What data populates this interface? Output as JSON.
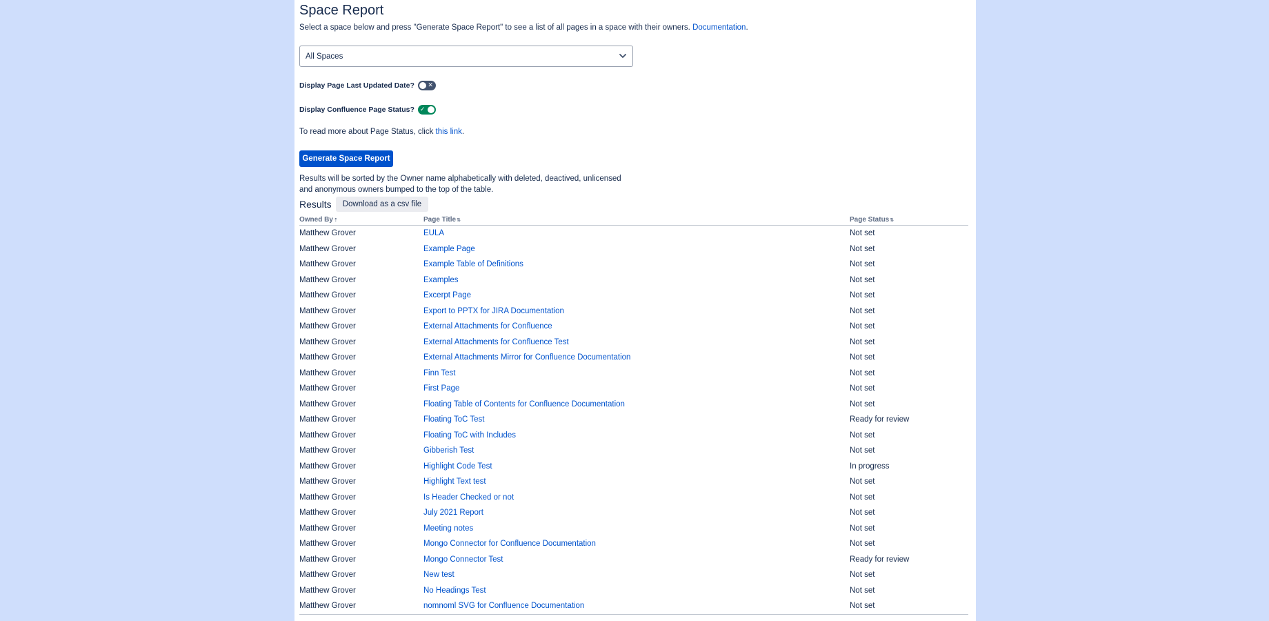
{
  "header": {
    "title": "Space Report",
    "intro_text": "Select a space below and press \"Generate Space Report\" to see a list of all pages in a space with their owners.",
    "intro_link": "Documentation",
    "intro_end": "."
  },
  "space_select": {
    "value": "All Spaces",
    "icon": "chevron-down-icon"
  },
  "options": {
    "last_updated_label": "Display Page Last Updated Date?",
    "last_updated_on": false,
    "page_status_label": "Display Confluence Page Status?",
    "page_status_on": true
  },
  "more_info": {
    "text": "To read more about Page Status, click",
    "link": "this link",
    "end": "."
  },
  "generate_button": "Generate Space Report",
  "sort_note": "Results will be sorted by the Owner name alphabetically with deleted, deactived, unlicensed and anonymous owners bumped to the top of the table.",
  "results": {
    "label": "Results",
    "download_button": "Download as a csv file",
    "columns": [
      "Owned By",
      "Page Title",
      "Page Status"
    ],
    "rows": [
      {
        "owner": "Matthew Grover",
        "title": "EULA",
        "status": "Not set"
      },
      {
        "owner": "Matthew Grover",
        "title": "Example Page",
        "status": "Not set"
      },
      {
        "owner": "Matthew Grover",
        "title": "Example Table of Definitions",
        "status": "Not set"
      },
      {
        "owner": "Matthew Grover",
        "title": "Examples",
        "status": "Not set"
      },
      {
        "owner": "Matthew Grover",
        "title": "Excerpt Page",
        "status": "Not set"
      },
      {
        "owner": "Matthew Grover",
        "title": "Export to PPTX for JIRA Documentation",
        "status": "Not set"
      },
      {
        "owner": "Matthew Grover",
        "title": "External Attachments for Confluence",
        "status": "Not set"
      },
      {
        "owner": "Matthew Grover",
        "title": "External Attachments for Confluence Test",
        "status": "Not set"
      },
      {
        "owner": "Matthew Grover",
        "title": "External Attachments Mirror for Confluence Documentation",
        "status": "Not set"
      },
      {
        "owner": "Matthew Grover",
        "title": "Finn Test",
        "status": "Not set"
      },
      {
        "owner": "Matthew Grover",
        "title": "First Page",
        "status": "Not set"
      },
      {
        "owner": "Matthew Grover",
        "title": "Floating Table of Contents for Confluence Documentation",
        "status": "Not set"
      },
      {
        "owner": "Matthew Grover",
        "title": "Floating ToC Test",
        "status": "Ready for review"
      },
      {
        "owner": "Matthew Grover",
        "title": "Floating ToC with Includes",
        "status": "Not set"
      },
      {
        "owner": "Matthew Grover",
        "title": "Gibberish Test",
        "status": "Not set"
      },
      {
        "owner": "Matthew Grover",
        "title": "Highlight Code Test",
        "status": "In progress"
      },
      {
        "owner": "Matthew Grover",
        "title": "Highlight Text test",
        "status": "Not set"
      },
      {
        "owner": "Matthew Grover",
        "title": "Is Header Checked or not",
        "status": "Not set"
      },
      {
        "owner": "Matthew Grover",
        "title": "July 2021 Report",
        "status": "Not set"
      },
      {
        "owner": "Matthew Grover",
        "title": "Meeting notes",
        "status": "Not set"
      },
      {
        "owner": "Matthew Grover",
        "title": "Mongo Connector for Confluence Documentation",
        "status": "Not set"
      },
      {
        "owner": "Matthew Grover",
        "title": "Mongo Connector Test",
        "status": "Ready for review"
      },
      {
        "owner": "Matthew Grover",
        "title": "New test",
        "status": "Not set"
      },
      {
        "owner": "Matthew Grover",
        "title": "No Headings Test",
        "status": "Not set"
      },
      {
        "owner": "Matthew Grover",
        "title": "nomnoml SVG for Confluence Documentation",
        "status": "Not set"
      }
    ]
  },
  "colors": {
    "background": "#cfdefc",
    "panel": "#ffffff",
    "link": "#0052cc",
    "primary_button": "#0052cc",
    "toggle_on": "#00875a",
    "toggle_off": "#42526e",
    "text": "#172b4d"
  }
}
